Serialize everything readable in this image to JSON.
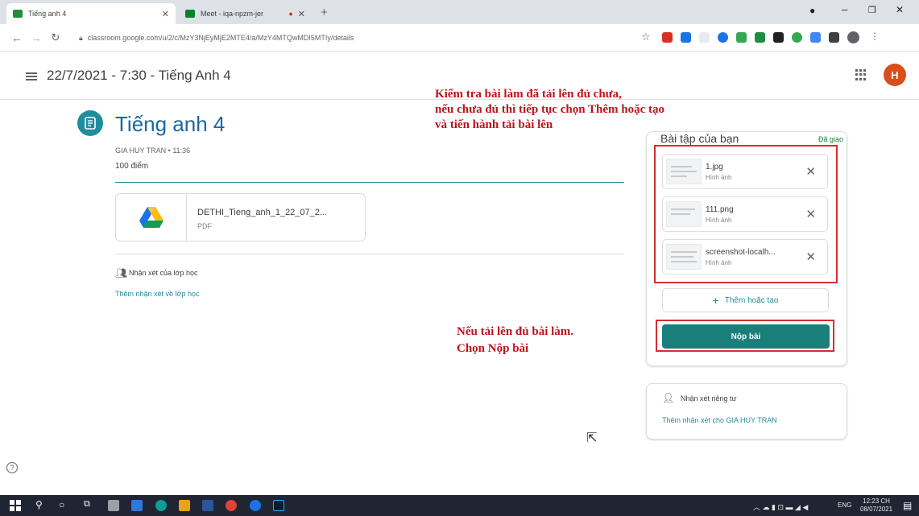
{
  "browser": {
    "tabs": [
      {
        "label": "Tiếng anh 4",
        "active": true
      },
      {
        "label": "Meet - iqa-npzm-jer",
        "active": false
      }
    ],
    "url": "classroom.google.com/u/2/c/MzY3NjEyMjE2MTE4/a/MzY4MTQwMDI5MTIy/details"
  },
  "header": {
    "title": "22/7/2021 - 7:30 - Tiếng Anh 4",
    "avatar_letter": "H"
  },
  "assignment": {
    "title": "Tiếng anh 4",
    "meta": "GIA HUY TRAN • 11:36",
    "points": "100 điểm",
    "attachment": {
      "name": "DETHI_Tieng_anh_1_22_07_2...",
      "type": "PDF"
    },
    "class_comments_label": "Nhận xét của lớp học",
    "class_comments_link": "Thêm nhận xét về lớp học"
  },
  "work": {
    "title": "Bài tập của bạn",
    "status": "Đã giao",
    "files": [
      {
        "name": "1.jpg",
        "type": "Hình ảnh"
      },
      {
        "name": "111.png",
        "type": "Hình ảnh"
      },
      {
        "name": "screenshot-localh...",
        "type": "Hình ảnh"
      }
    ],
    "add_label": "Thêm hoặc tạo",
    "submit_label": "Nộp bài"
  },
  "private": {
    "label": "Nhận xét riêng tư",
    "link": "Thêm nhận xét cho GIA HUY TRAN"
  },
  "annotations": {
    "top_line1": "Kiểm tra bài làm đã tải lên đủ chưa,",
    "top_line2": "nếu chưa đủ thì tiếp tục chọn Thêm hoặc tạo",
    "top_line3": "và tiến hành tải bài lên",
    "bottom_line1": "Nếu tải lên đủ bài làm.",
    "bottom_line2": "Chọn Nộp bài"
  },
  "taskbar": {
    "lang": "ENG",
    "time": "12:23 CH",
    "date": "08/07/2021"
  },
  "colors": {
    "accent": "#1e8e9e",
    "submit": "#1a7f7a",
    "annotation": "#c0121b"
  }
}
